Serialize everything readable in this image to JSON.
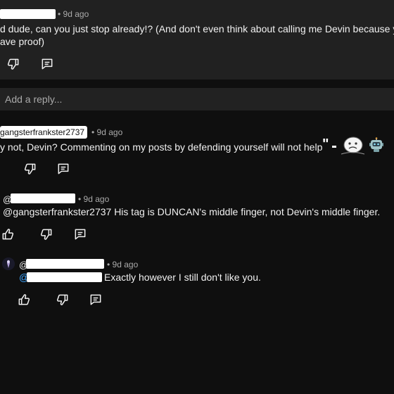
{
  "comment_top": {
    "time": "• 9d ago",
    "text_line1": "d dude, can you just stop already!? (And don't even think about calling me Devin because y",
    "text_line2": "ave proof)",
    "icons": [
      "thumbs-down-icon",
      "reply-icon"
    ]
  },
  "reply_box": {
    "placeholder": "Add a reply..."
  },
  "reply1": {
    "handle": "gangsterfrankster2737",
    "time": "• 9d ago",
    "text": "y not, Devin? Commenting on my posts by defending yourself will not help",
    "quote_mark": "\"",
    "emojis": [
      "dash-emoji",
      "sad-face-emoji",
      "robot-emoji"
    ],
    "icons": [
      "thumbs-down-icon",
      "reply-icon"
    ]
  },
  "reply2": {
    "at": "@",
    "time": "• 9d ago",
    "text": "@gangsterfrankster2737 His tag is DUNCAN's middle finger, not Devin's middle finger.",
    "icons": [
      "thumbs-up-icon",
      "thumbs-down-icon",
      "reply-icon"
    ]
  },
  "reply3": {
    "at": "@",
    "time": "• 9d ago",
    "mention_at": "@",
    "text": "Exactly however I still don't like you.",
    "icons": [
      "thumbs-up-icon",
      "thumbs-down-icon",
      "reply-icon"
    ]
  },
  "colors": {
    "background": "#0f0f0f",
    "panel": "#212121",
    "text": "#f1f1f1",
    "meta": "#aaaaaa",
    "mention": "#3ea6ff"
  }
}
